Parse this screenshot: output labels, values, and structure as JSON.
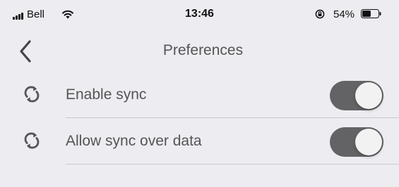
{
  "status_bar": {
    "carrier": "Bell",
    "time": "13:46",
    "battery_percent": "54%",
    "battery_level": 0.54
  },
  "nav": {
    "title": "Preferences",
    "back_icon": "chevron-left-icon"
  },
  "settings": [
    {
      "label": "Enable sync",
      "icon": "sync-icon",
      "enabled": true
    },
    {
      "label": "Allow sync over data",
      "icon": "sync-icon",
      "enabled": true
    }
  ],
  "colors": {
    "background": "#ececf1",
    "toggle_on": "#636366",
    "text": "#555555"
  }
}
